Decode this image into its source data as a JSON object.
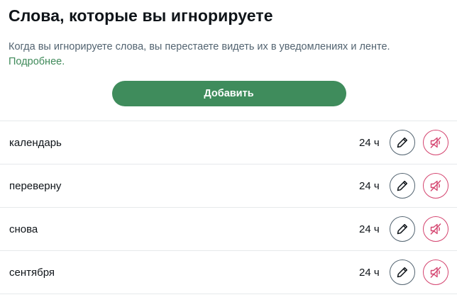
{
  "header": {
    "title": "Слова, которые вы игнорируете",
    "description": "Когда вы игнорируете слова, вы перестаете видеть их в уведомлениях и ленте.",
    "learn_more": "Подробнее."
  },
  "add_button_label": "Добавить",
  "muted_words": [
    {
      "word": "календарь",
      "duration": "24 ч"
    },
    {
      "word": "переверну",
      "duration": "24 ч"
    },
    {
      "word": "снова",
      "duration": "24 ч"
    },
    {
      "word": "сентября",
      "duration": "24 ч"
    }
  ],
  "icons": {
    "edit": "pencil-icon",
    "unmute": "speaker-muted-icon"
  },
  "colors": {
    "accent": "#3f8c5c",
    "link": "#3f8a5a",
    "unmute": "#d4446f",
    "edit_border": "#536471"
  }
}
